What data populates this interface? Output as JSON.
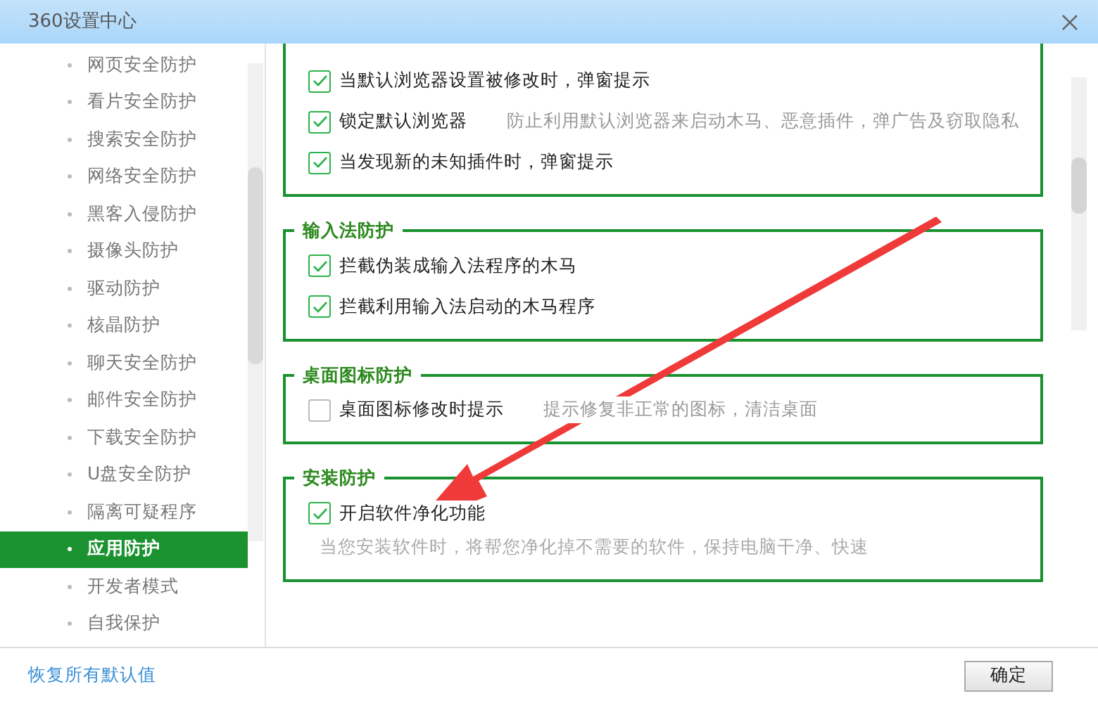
{
  "window": {
    "title": "360设置中心"
  },
  "sidebar": {
    "items": [
      {
        "label": "网页安全防护",
        "selected": false
      },
      {
        "label": "看片安全防护",
        "selected": false
      },
      {
        "label": "搜索安全防护",
        "selected": false
      },
      {
        "label": "网络安全防护",
        "selected": false
      },
      {
        "label": "黑客入侵防护",
        "selected": false
      },
      {
        "label": "摄像头防护",
        "selected": false
      },
      {
        "label": "驱动防护",
        "selected": false
      },
      {
        "label": "核晶防护",
        "selected": false
      },
      {
        "label": "聊天安全防护",
        "selected": false
      },
      {
        "label": "邮件安全防护",
        "selected": false
      },
      {
        "label": "下载安全防护",
        "selected": false
      },
      {
        "label": "U盘安全防护",
        "selected": false
      },
      {
        "label": "隔离可疑程序",
        "selected": false
      },
      {
        "label": "应用防护",
        "selected": true
      },
      {
        "label": "开发者模式",
        "selected": false
      },
      {
        "label": "自我保护",
        "selected": false
      }
    ]
  },
  "groups": [
    {
      "items": [
        {
          "label": "当默认浏览器设置被修改时，弹窗提示",
          "checked": true
        },
        {
          "label": "锁定默认浏览器",
          "checked": true,
          "description": "防止利用默认浏览器来启动木马、恶意插件，弹广告及窃取隐私"
        },
        {
          "label": "当发现新的未知插件时，弹窗提示",
          "checked": true
        }
      ]
    },
    {
      "title": "输入法防护",
      "items": [
        {
          "label": "拦截伪装成输入法程序的木马",
          "checked": true
        },
        {
          "label": "拦截利用输入法启动的木马程序",
          "checked": true
        }
      ]
    },
    {
      "title": "桌面图标防护",
      "items": [
        {
          "label": "桌面图标修改时提示",
          "checked": false,
          "description": "提示修复非正常的图标，清洁桌面"
        }
      ]
    },
    {
      "title": "安装防护",
      "items": [
        {
          "label": "开启软件净化功能",
          "checked": true
        }
      ],
      "note": "当您安装软件时，将帮您净化掉不需要的软件，保持电脑干净、快速"
    }
  ],
  "footer": {
    "reset_link": "恢复所有默认值",
    "ok_button": "确定"
  }
}
